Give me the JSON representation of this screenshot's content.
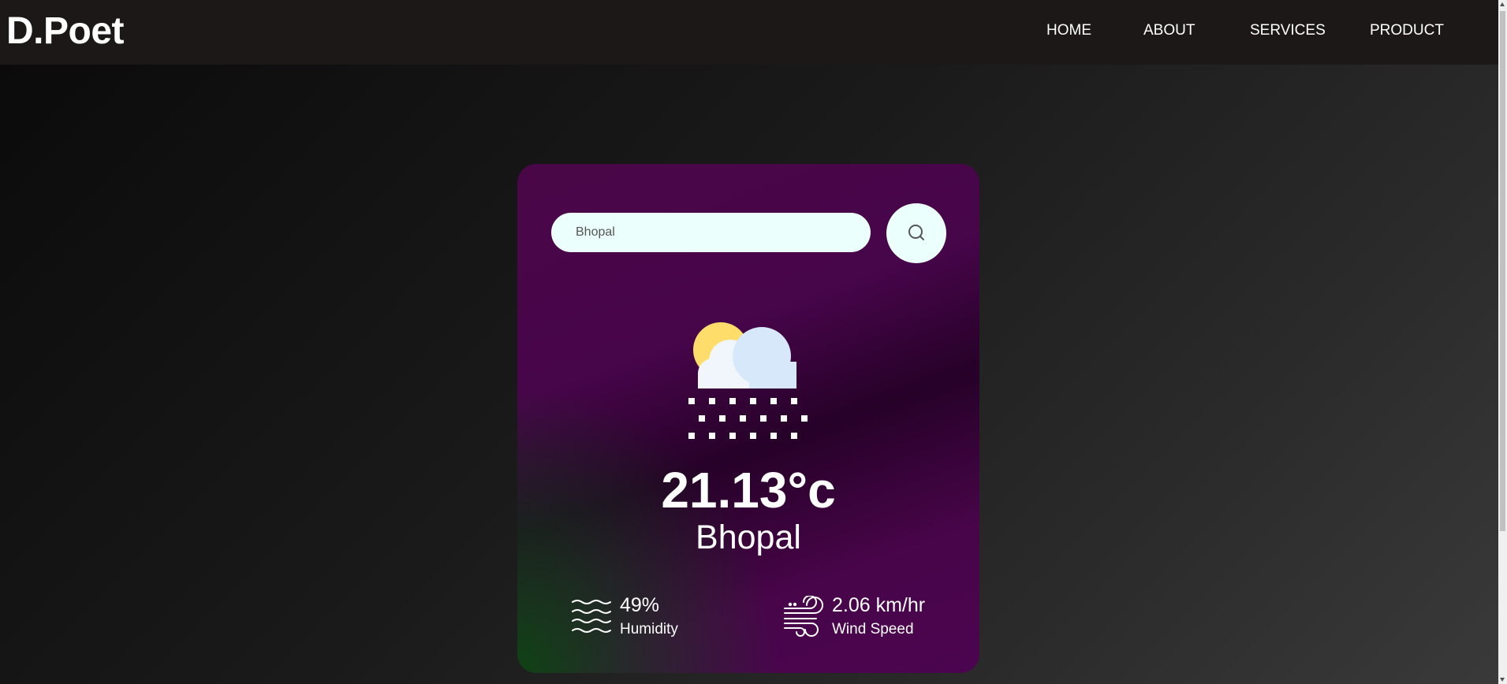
{
  "header": {
    "logo": "D.Poet",
    "nav": [
      {
        "label": "HOME"
      },
      {
        "label": "ABOUT"
      },
      {
        "label": "SERVICES"
      },
      {
        "label": "PRODUCT"
      }
    ]
  },
  "search": {
    "value": "Bhopal",
    "icon": "search-icon"
  },
  "weather": {
    "icon": "partly-cloudy-snow-icon",
    "temperature": "21.13°c",
    "city": "Bhopal"
  },
  "details": {
    "humidity": {
      "value": "49%",
      "label": "Humidity",
      "icon": "humidity-icon"
    },
    "wind": {
      "value": "2.06 km/hr",
      "label": "Wind Speed",
      "icon": "wind-icon"
    }
  },
  "colors": {
    "navbar": "#1c1817",
    "card_purple": "#4a0748",
    "card_green": "#0c4612",
    "input_bg": "#ebfffc",
    "text": "#ffffff"
  }
}
